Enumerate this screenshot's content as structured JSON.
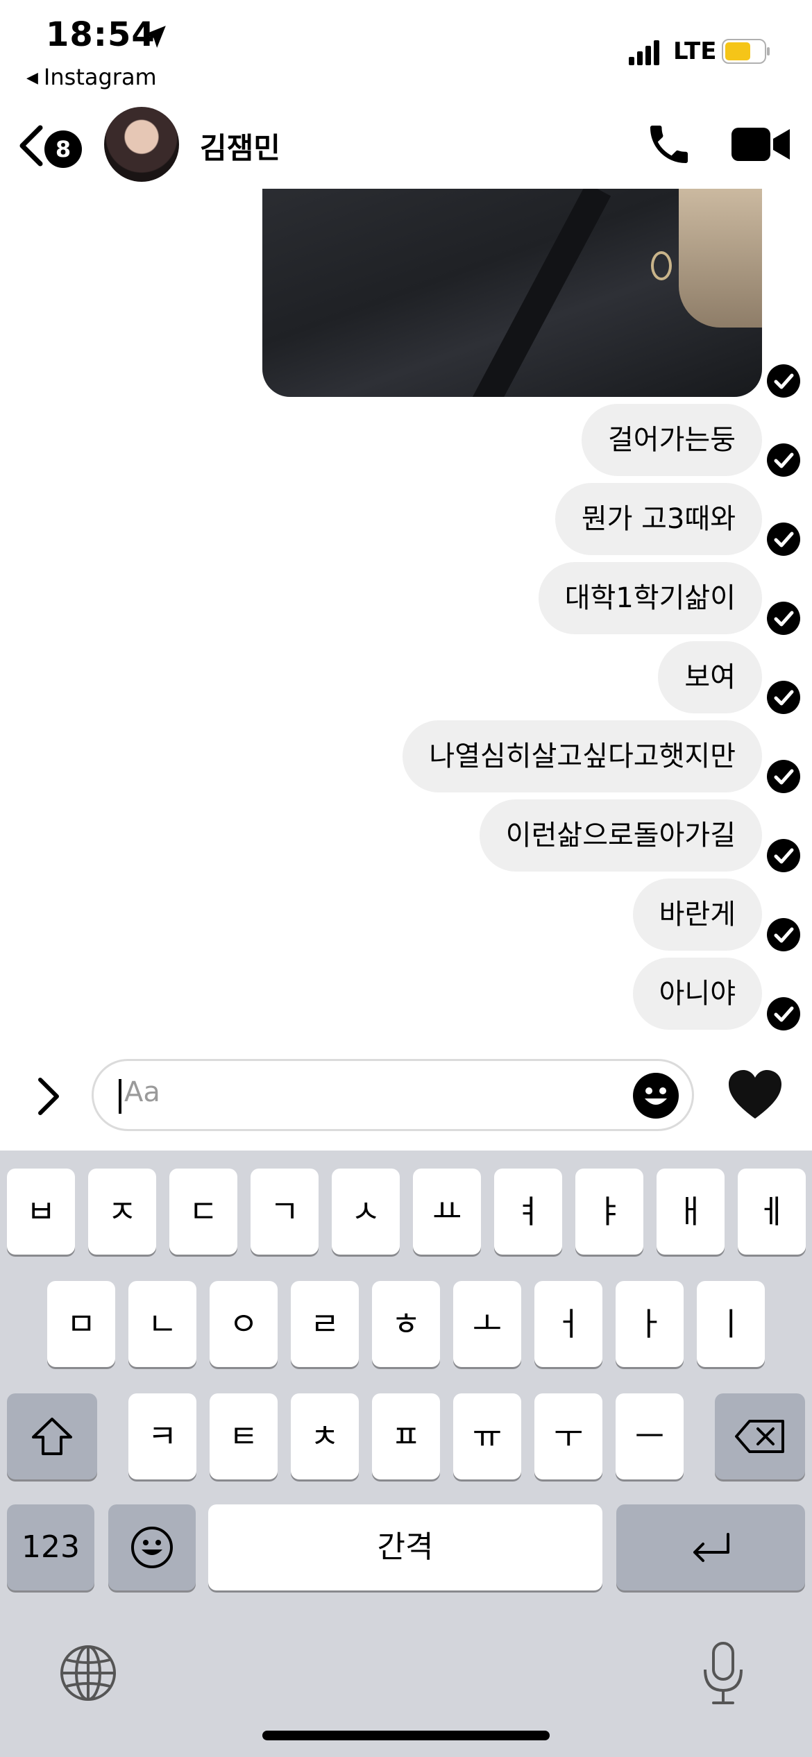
{
  "status_bar": {
    "time": "18:54",
    "back_app": "Instagram",
    "network": "LTE"
  },
  "header": {
    "unread_count": "8",
    "contact_name": "김잼민"
  },
  "messages": [
    "걸어가는둥",
    "뭔가 고3때와",
    "대학1학기삶이",
    "보여",
    "나열심히살고싶다고햇지만",
    "이런삶으로돌아가길",
    "바란게",
    "아니야"
  ],
  "composer": {
    "placeholder": "Aa"
  },
  "keyboard": {
    "row1": [
      "ㅂ",
      "ㅈ",
      "ㄷ",
      "ㄱ",
      "ㅅ",
      "ㅛ",
      "ㅕ",
      "ㅑ",
      "ㅐ",
      "ㅔ"
    ],
    "row2": [
      "ㅁ",
      "ㄴ",
      "ㅇ",
      "ㄹ",
      "ㅎ",
      "ㅗ",
      "ㅓ",
      "ㅏ",
      "ㅣ"
    ],
    "row3": [
      "ㅋ",
      "ㅌ",
      "ㅊ",
      "ㅍ",
      "ㅠ",
      "ㅜ",
      "ㅡ"
    ],
    "numbers_label": "123",
    "space_label": "간격"
  },
  "colors": {
    "bubble": "#efefef",
    "keyboard_bg": "#d3d5db",
    "battery": "#f5c518"
  }
}
